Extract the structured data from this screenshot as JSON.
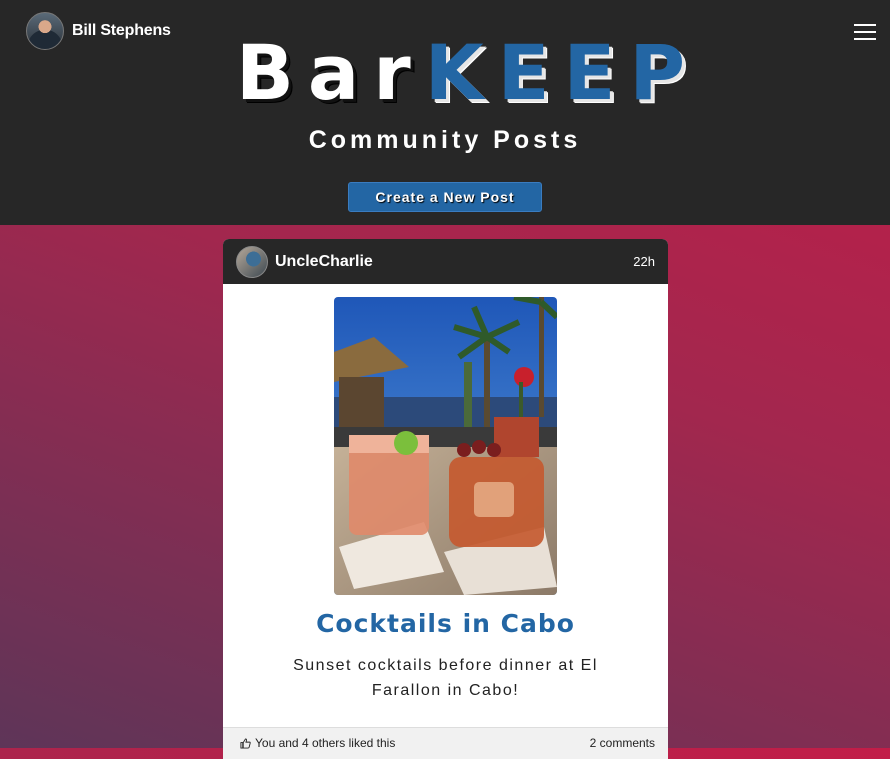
{
  "header": {
    "user_name": "Bill Stephens",
    "logo_part1": "Bar",
    "logo_part2": "KEEP",
    "subtitle": "Community Posts",
    "create_button": "Create a New Post"
  },
  "post": {
    "author": "UncleCharlie",
    "time": "22h",
    "title": "Cocktails in Cabo",
    "body": "Sunset cocktails before dinner at El Farallon in Cabo!",
    "likes_text": "You and 4 others liked this",
    "comments_text": "2 comments"
  },
  "colors": {
    "brand_blue": "#2366a4",
    "header_bg": "#272727",
    "gradient_top": "#c21d48",
    "gradient_bottom": "#5e3558"
  },
  "icons": {
    "menu": "hamburger-icon",
    "like": "thumbs-up-icon"
  }
}
